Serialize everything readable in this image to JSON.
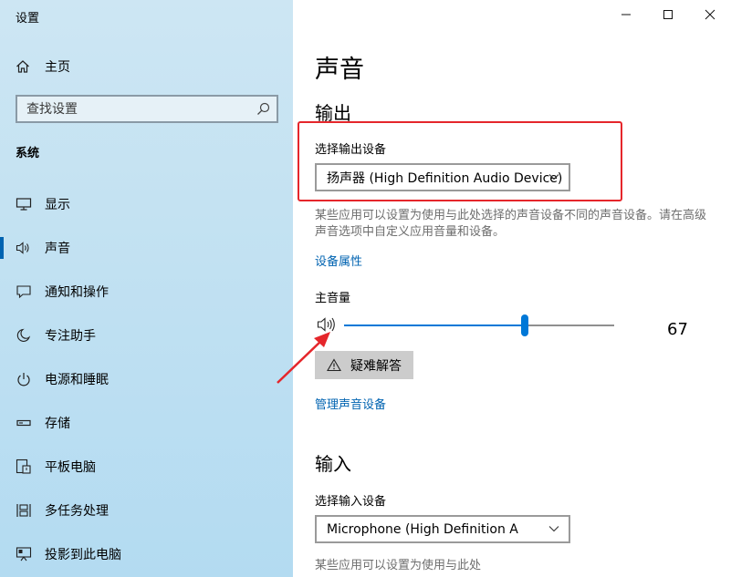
{
  "window": {
    "title": "设置",
    "controls": [
      "minimize",
      "maximize",
      "close"
    ]
  },
  "sidebar": {
    "home_label": "主页",
    "search_placeholder": "查找设置",
    "section_label": "系统",
    "items": [
      {
        "label": "显示",
        "icon": "display-icon",
        "active": false
      },
      {
        "label": "声音",
        "icon": "speaker-icon",
        "active": true
      },
      {
        "label": "通知和操作",
        "icon": "notification-icon",
        "active": false
      },
      {
        "label": "专注助手",
        "icon": "moon-icon",
        "active": false
      },
      {
        "label": "电源和睡眠",
        "icon": "power-icon",
        "active": false
      },
      {
        "label": "存储",
        "icon": "storage-icon",
        "active": false
      },
      {
        "label": "平板电脑",
        "icon": "tablet-icon",
        "active": false
      },
      {
        "label": "多任务处理",
        "icon": "multitask-icon",
        "active": false
      },
      {
        "label": "投影到此电脑",
        "icon": "project-icon",
        "active": false
      }
    ]
  },
  "main": {
    "title": "声音",
    "output": {
      "heading": "输出",
      "select_label": "选择输出设备",
      "selected_device": "扬声器 (High Definition Audio Device)",
      "description": "某些应用可以设置为使用与此处选择的声音设备不同的声音设备。请在高级声音选项中自定义应用音量和设备。",
      "device_properties_link": "设备属性",
      "master_volume_label": "主音量",
      "volume": 67,
      "volume_display": "67",
      "troubleshoot_label": "疑难解答",
      "manage_devices_link": "管理声音设备"
    },
    "input": {
      "heading": "输入",
      "select_label": "选择输入设备",
      "selected_device": "Microphone (High Definition A",
      "description": "某些应用可以设置为使用与此处"
    }
  },
  "colors": {
    "accent": "#0078d7",
    "link": "#0063b1",
    "annotation": "#e5262b",
    "sidebar_bg": "#c4e2f2"
  }
}
